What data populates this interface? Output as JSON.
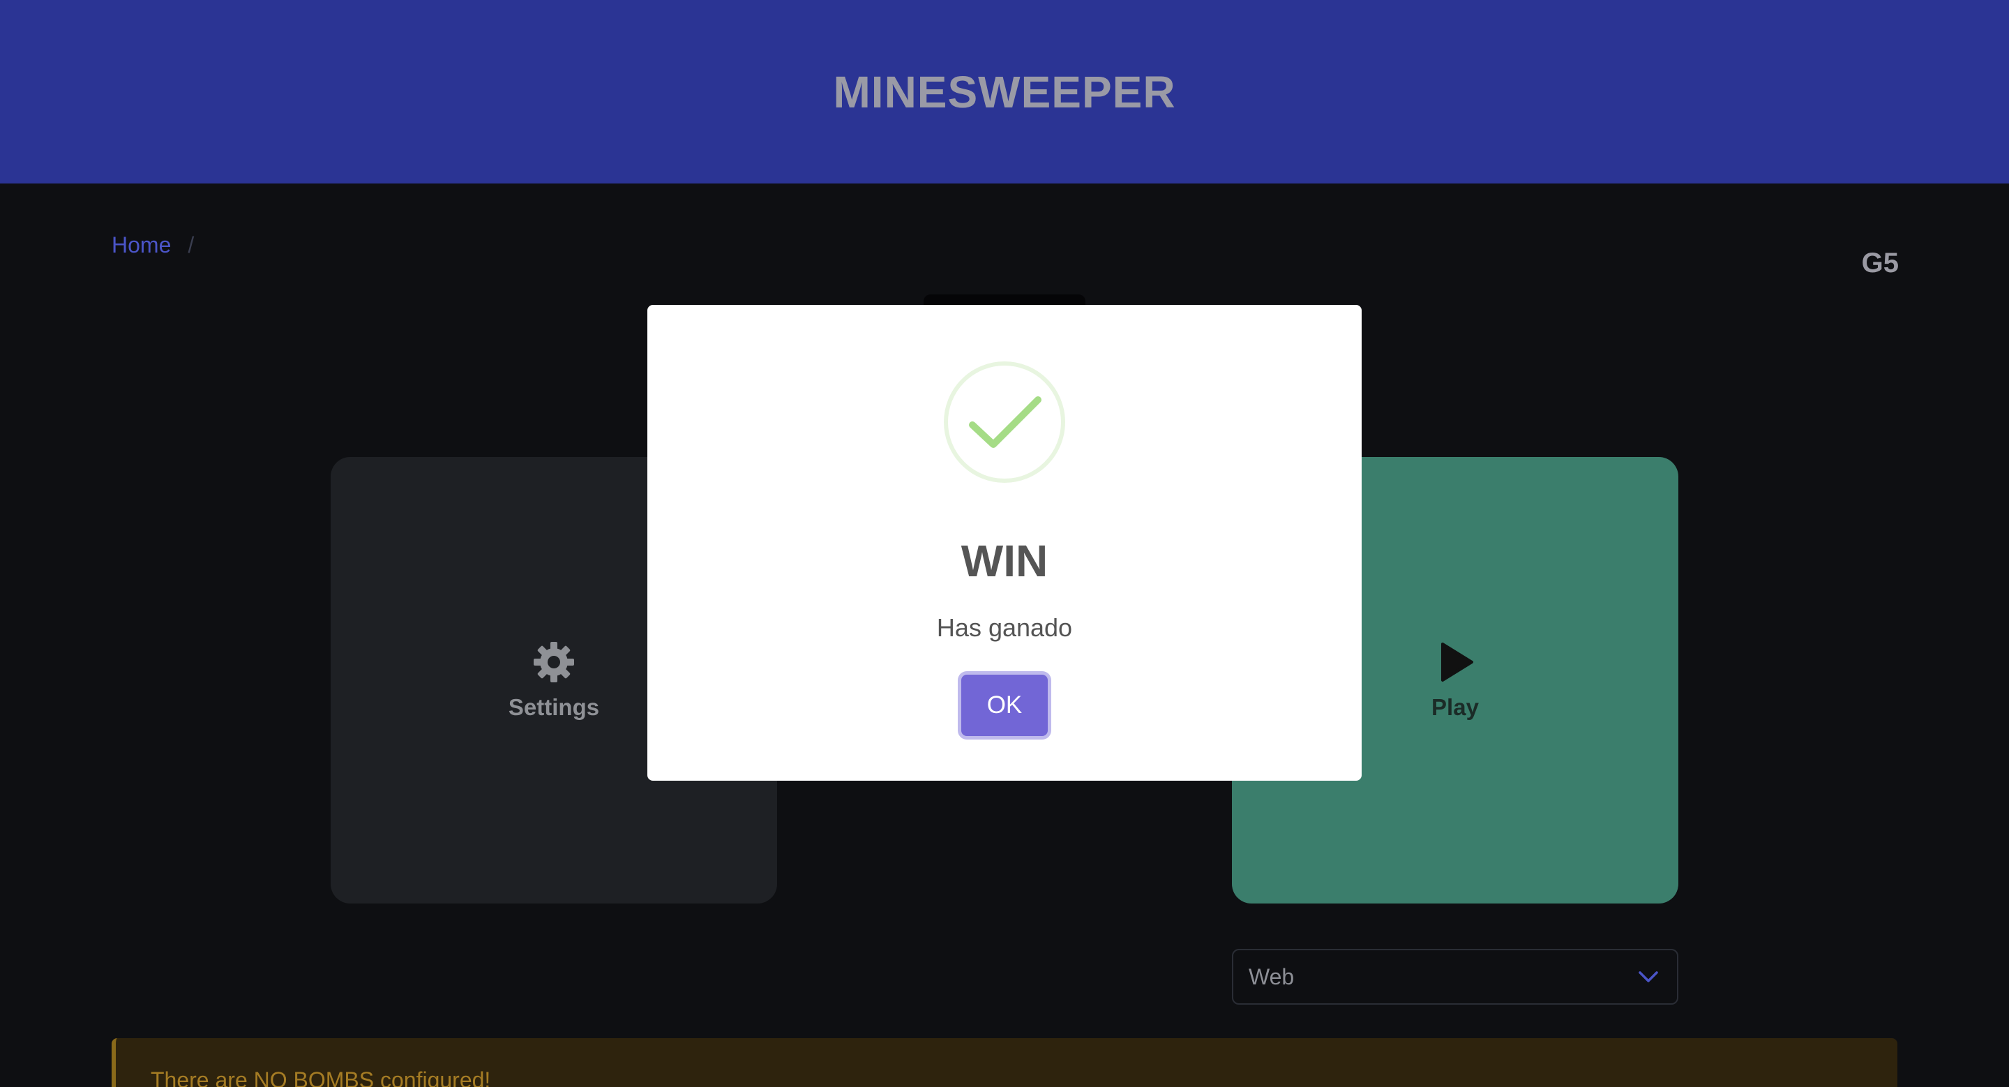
{
  "header": {
    "title": "MINESWEEPER"
  },
  "breadcrumb": {
    "home": "Home",
    "separator": "/"
  },
  "group_label": "G5",
  "cards": {
    "settings": {
      "label": "Settings",
      "icon": "gear-icon"
    },
    "play": {
      "label": "Play",
      "icon": "play-icon"
    }
  },
  "mode_select": {
    "value": "Web",
    "icon": "chevron-down-icon"
  },
  "warning": {
    "text": "There are NO BOMBS configured!"
  },
  "modal": {
    "icon": "checkmark-circle-icon",
    "title": "WIN",
    "text": "Has ganado",
    "ok_label": "OK"
  },
  "colors": {
    "header_bg": "#2b3494",
    "page_bg": "#0e0f12",
    "play_card": "#3b7e6c",
    "settings_card": "#1e2024",
    "ok_button": "#7266d6",
    "success_green": "#a5dc86",
    "warning_bg": "#2e230d",
    "warning_text": "#a57c24"
  }
}
